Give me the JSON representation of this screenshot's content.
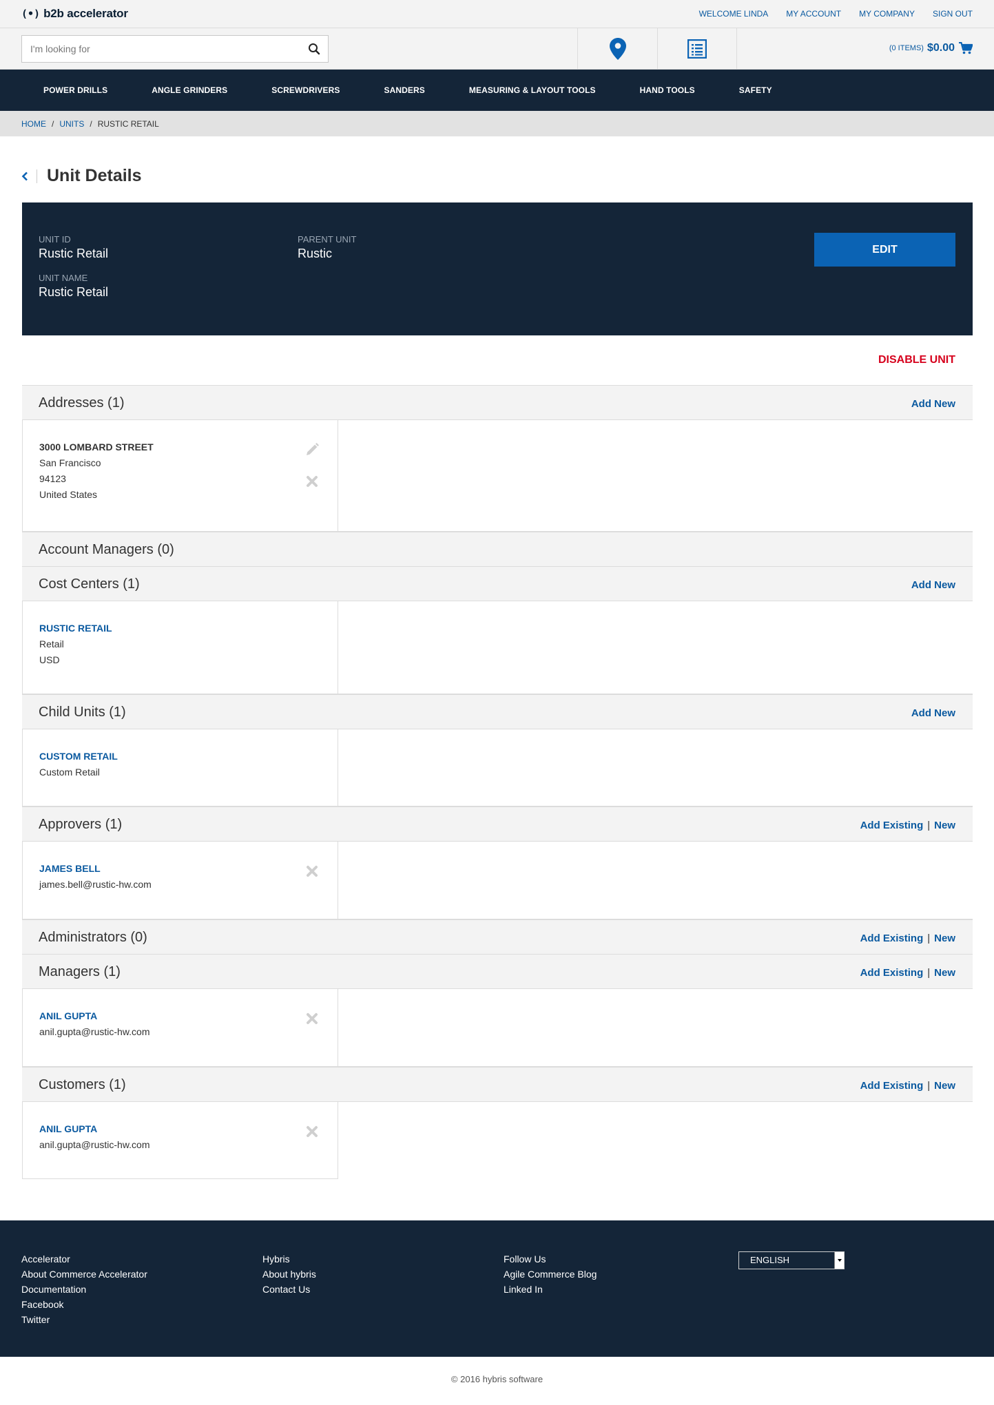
{
  "header": {
    "logo_mark": "(•)",
    "logo_text": "b2b accelerator",
    "links": [
      "WELCOME LINDA",
      "MY ACCOUNT",
      "MY COMPANY",
      "SIGN OUT"
    ]
  },
  "search": {
    "placeholder": "I'm looking for",
    "value": ""
  },
  "cart": {
    "items": "(0 ITEMS)",
    "total": "$0.00"
  },
  "nav": [
    "POWER DRILLS",
    "ANGLE GRINDERS",
    "SCREWDRIVERS",
    "SANDERS",
    "MEASURING & LAYOUT TOOLS",
    "HAND TOOLS",
    "SAFETY"
  ],
  "breadcrumb": {
    "home": "HOME",
    "units": "UNITS",
    "sep": "/",
    "current": "RUSTIC RETAIL"
  },
  "page_title": "Unit Details",
  "details": {
    "unit_id_label": "UNIT ID",
    "unit_id": "Rustic Retail",
    "parent_label": "PARENT UNIT",
    "parent": "Rustic",
    "name_label": "UNIT NAME",
    "name": "Rustic Retail",
    "edit_label": "EDIT"
  },
  "disable_label": "DISABLE UNIT",
  "sections": {
    "addresses": {
      "title": "Addresses (1)",
      "add": "Add New",
      "card": {
        "street": "3000 LOMBARD STREET",
        "city": "San Francisco",
        "zip": "94123",
        "country": "United States"
      }
    },
    "account_managers": {
      "title": "Account Managers (0)"
    },
    "cost_centers": {
      "title": "Cost Centers (1)",
      "add": "Add New",
      "card": {
        "name": "RUSTIC RETAIL",
        "type": "Retail",
        "currency": "USD"
      }
    },
    "child_units": {
      "title": "Child Units (1)",
      "add": "Add New",
      "card": {
        "name": "CUSTOM RETAIL",
        "sub": "Custom Retail"
      }
    },
    "approvers": {
      "title": "Approvers (1)",
      "add_existing": "Add Existing",
      "sep": "|",
      "new": "New",
      "card": {
        "name": "JAMES BELL",
        "email": "james.bell@rustic-hw.com"
      }
    },
    "administrators": {
      "title": "Administrators (0)",
      "add_existing": "Add Existing",
      "sep": "|",
      "new": "New"
    },
    "managers": {
      "title": "Managers (1)",
      "add_existing": "Add Existing",
      "sep": "|",
      "new": "New",
      "card": {
        "name": "ANIL GUPTA",
        "email": "anil.gupta@rustic-hw.com"
      }
    },
    "customers": {
      "title": "Customers (1)",
      "add_existing": "Add Existing",
      "sep": "|",
      "new": "New",
      "card": {
        "name": "ANIL GUPTA",
        "email": "anil.gupta@rustic-hw.com"
      }
    }
  },
  "footer": {
    "col1": [
      "Accelerator",
      "About Commerce Accelerator",
      "Documentation",
      "Facebook",
      "Twitter"
    ],
    "col2": [
      "Hybris",
      "About hybris",
      "Contact Us"
    ],
    "col3": [
      "Follow Us",
      "Agile Commerce Blog",
      "Linked In"
    ],
    "language": "ENGLISH"
  },
  "copyright": "© 2016 hybris software",
  "colors": {
    "navy": "#142538",
    "link": "#0b5aa0",
    "button": "#0b63b4",
    "danger": "#d6001c"
  },
  "icons": [
    "search-icon",
    "location-pin-icon",
    "list-icon",
    "cart-icon",
    "chevron-left-icon",
    "pencil-icon",
    "close-icon"
  ]
}
